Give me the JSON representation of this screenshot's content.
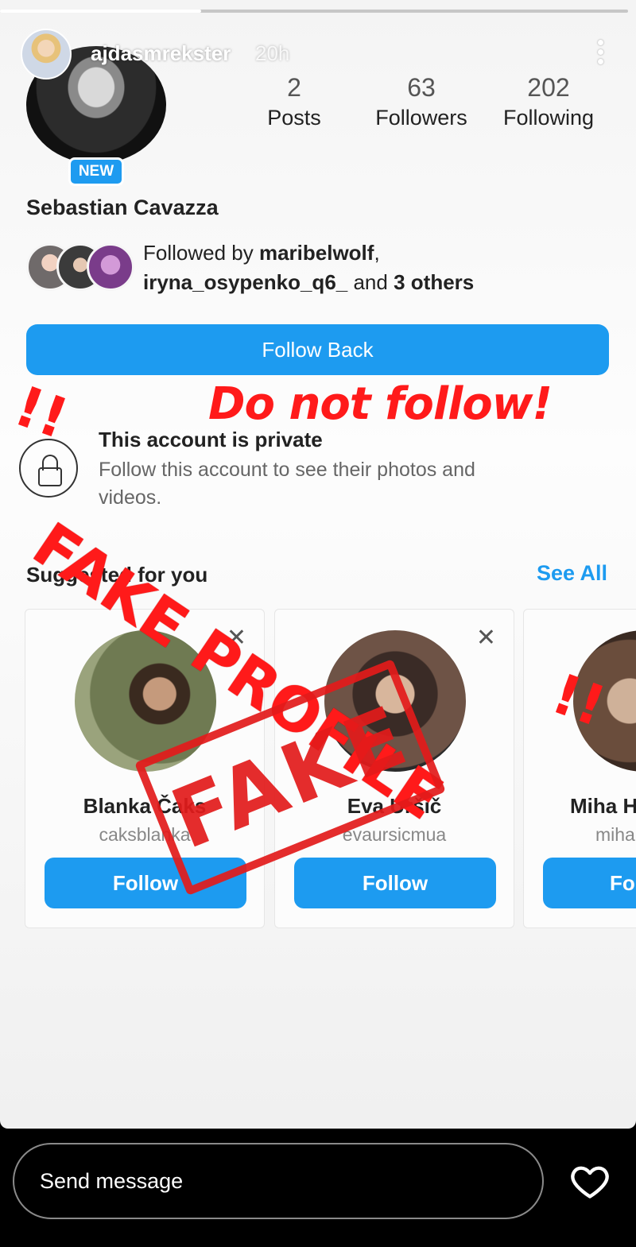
{
  "story": {
    "username": "ajdasmrekster",
    "time": "20h",
    "progress": 0.32
  },
  "profile": {
    "badge": "NEW",
    "display_name": "Sebastian Cavazza",
    "stats": [
      {
        "value": "2",
        "label": "Posts"
      },
      {
        "value": "63",
        "label": "Followers"
      },
      {
        "value": "202",
        "label": "Following"
      }
    ],
    "followed_by": {
      "prefix": "Followed by",
      "user1": "maribelwolf",
      "user2": "iryna_osypenko_q6_",
      "middle": "and",
      "others": "3 others"
    },
    "follow_back_label": "Follow Back",
    "private": {
      "title": "This account is private",
      "desc": "Follow this account to see their photos and videos."
    }
  },
  "suggested": {
    "title": "Suggested for you",
    "see_all": "See All",
    "cards": [
      {
        "name": "Blanka Čaks",
        "handle": "caksblanka",
        "button": "Follow"
      },
      {
        "name": "Eva Uršič",
        "handle": "evaursicmua",
        "button": "Follow"
      },
      {
        "name": "Miha H",
        "handle": "miha",
        "button": "Fo"
      }
    ]
  },
  "overlay": {
    "warning": "Do not follow!",
    "fake_profile": "FAKE PROFILE",
    "exclaim": "!!",
    "stamp": "FAKE",
    "color": "#ff1a1a"
  },
  "reply": {
    "placeholder": "Send message"
  },
  "icons": [
    "more-vert-icon",
    "lock-icon",
    "close-icon",
    "heart-icon"
  ]
}
